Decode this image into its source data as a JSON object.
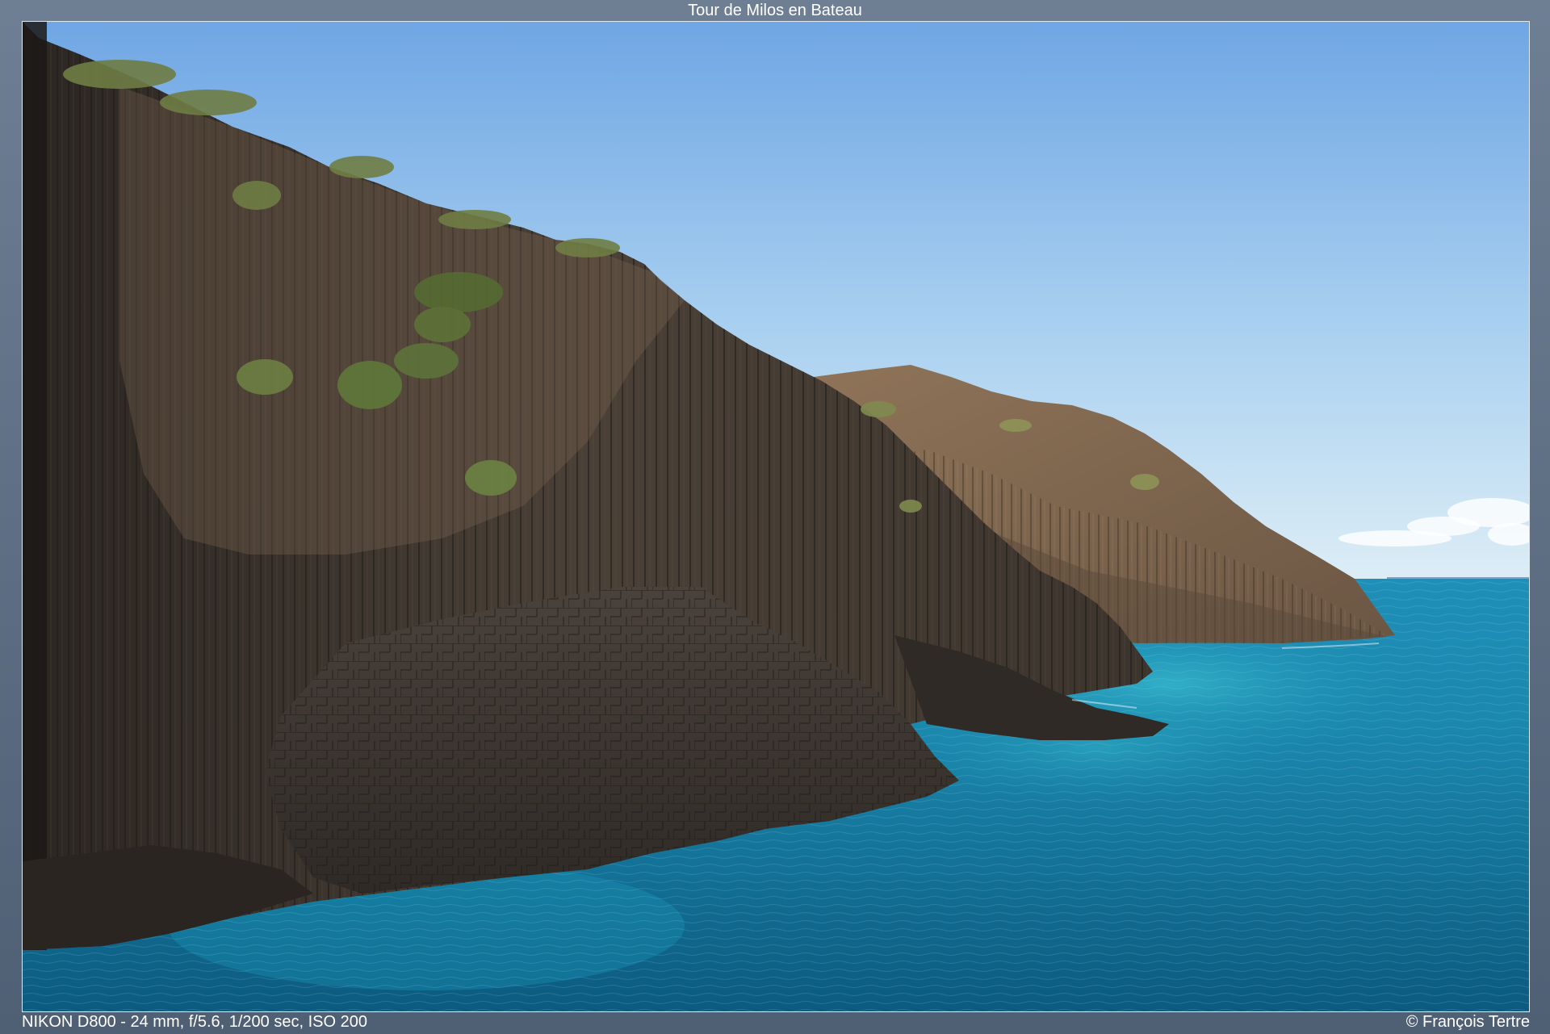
{
  "title": "Tour de Milos en Bateau",
  "exif": "NIKON D800 - 24 mm, f/5.6, 1/200 sec, ISO 200",
  "copyright": "© François Tertre",
  "colors": {
    "frame": "#5a6b80",
    "sky_top": "#6fa8e6",
    "sky_bottom": "#d8ebf5",
    "sea_light": "#2aa7c7",
    "sea_deep": "#0d5f86",
    "cliff_shadow": "#3b3631",
    "cliff_lit": "#8a6f55"
  }
}
